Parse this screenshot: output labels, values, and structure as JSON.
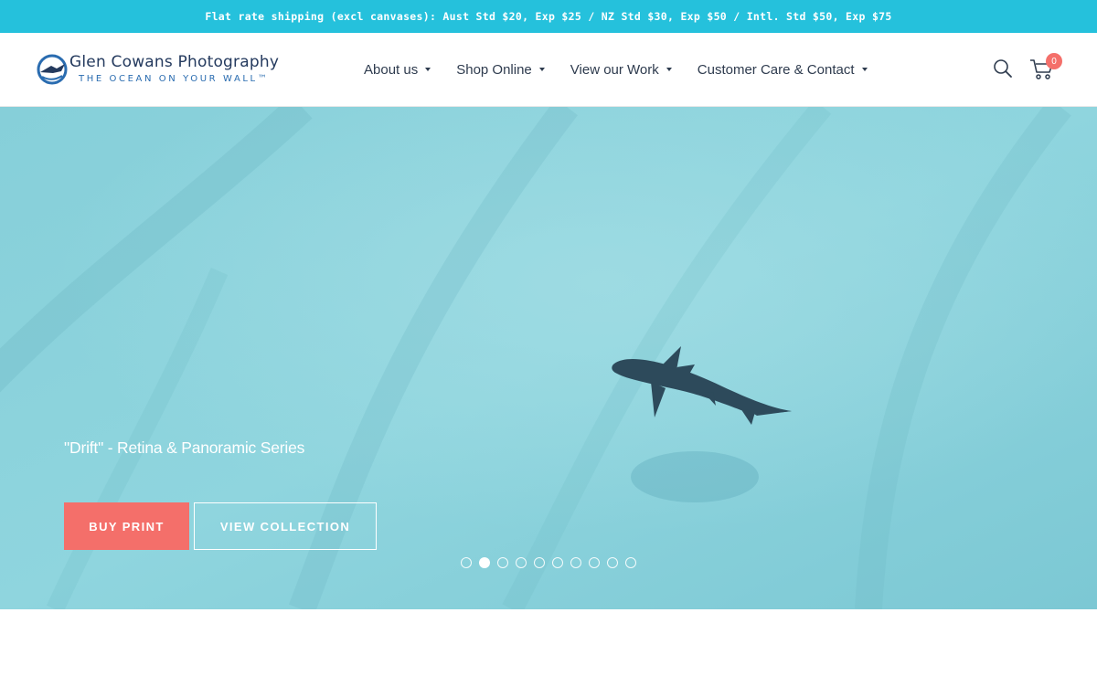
{
  "announcement": "Flat rate shipping (excl canvases): Aust Std $20, Exp $25 / NZ Std $30, Exp $50 / Intl. Std $50, Exp $75",
  "logo": {
    "name": "Glen Cowans Photography",
    "tagline": "THE OCEAN ON YOUR WALL™"
  },
  "nav": [
    {
      "label": "About us",
      "icon": "caret-down"
    },
    {
      "label": "Shop Online",
      "icon": "caret-down"
    },
    {
      "label": "View our Work",
      "icon": "caret-down"
    },
    {
      "label": "Customer Care & Contact",
      "icon": "caret-down"
    }
  ],
  "header_icons": {
    "search": "search-icon",
    "cart": "cart-icon"
  },
  "cart": {
    "count": "0"
  },
  "hero": {
    "caption": "\"Drift\" - Retina & Panoramic Series",
    "buy_label": "BUY PRINT",
    "view_label": "VIEW COLLECTION",
    "slides_total": 10,
    "active_slide": 2
  },
  "colors": {
    "announcement_bg": "#25c1dc",
    "accent": "#f46f6a",
    "water": "#7fd0db",
    "logo_text": "#243a5e"
  }
}
